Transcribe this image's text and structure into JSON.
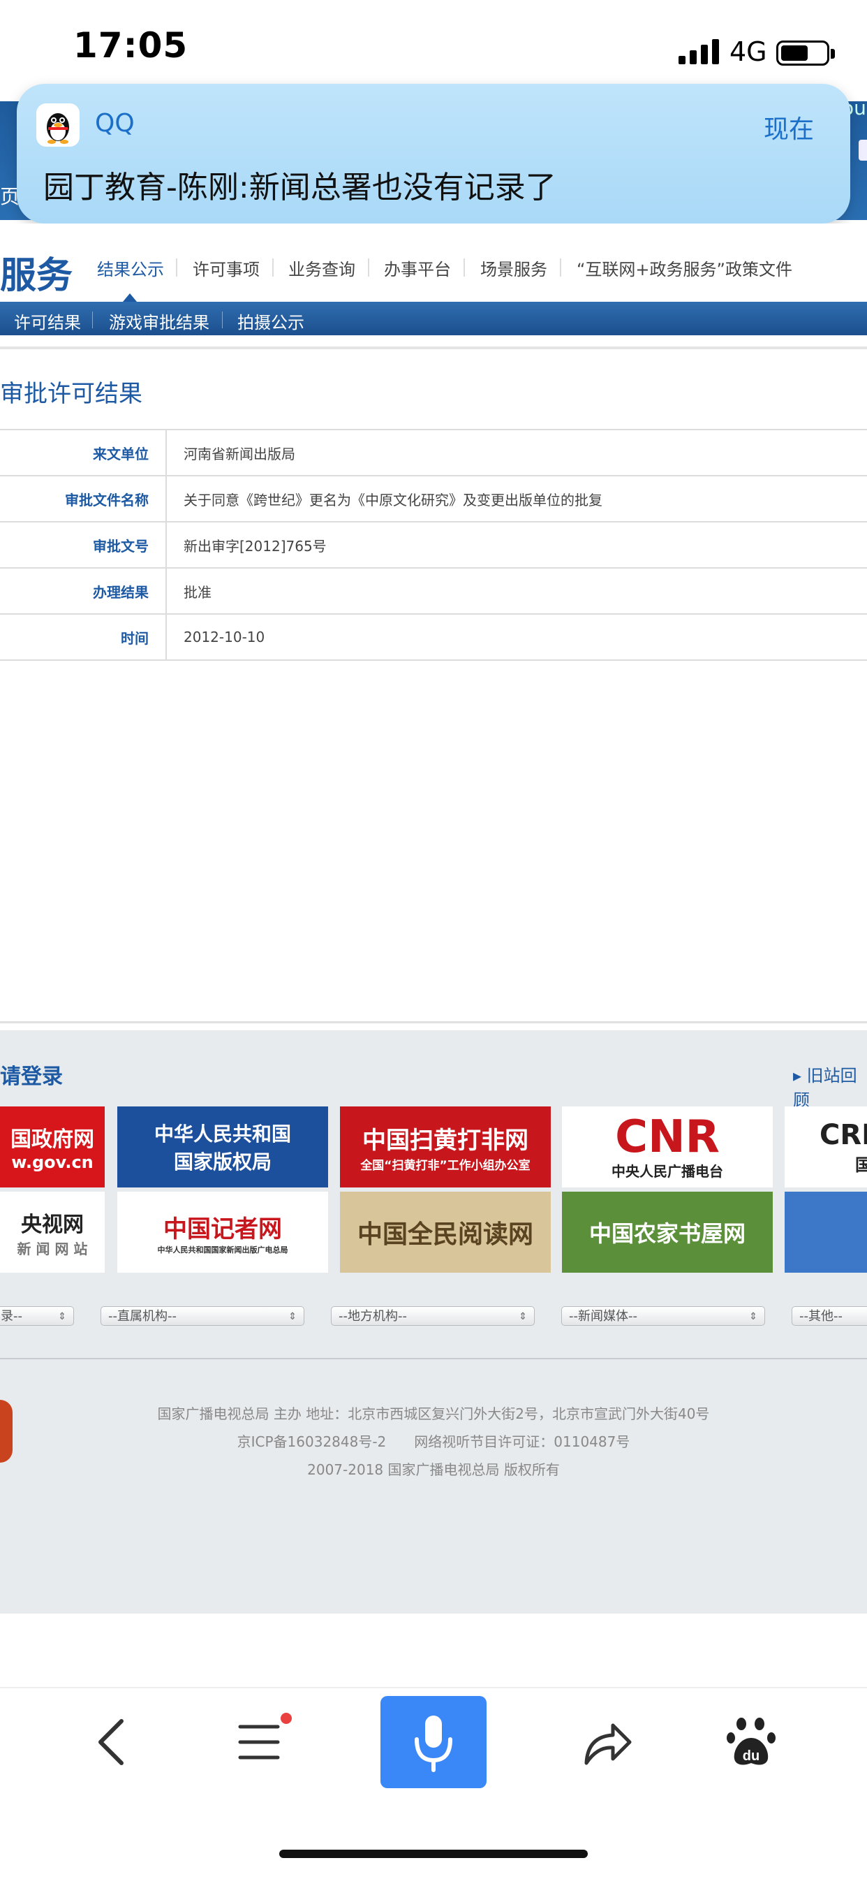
{
  "status_bar": {
    "time": "17:05",
    "network": "4G",
    "battery_level": 0.6
  },
  "notification": {
    "app": "QQ",
    "time": "现在",
    "message": "园丁教育-陈刚:新闻总署也没有记录了"
  },
  "site_header": {
    "left_fragment": "页",
    "right_fragment": "ou"
  },
  "nav": {
    "brand": "服务",
    "items": [
      "结果公示",
      "许可事项",
      "业务查询",
      "办事平台",
      "场景服务",
      "“互联网+政务服务”政策文件"
    ],
    "active": "结果公示"
  },
  "subnav": {
    "items": [
      "许可结果",
      "游戏审批结果",
      "拍摄公示"
    ]
  },
  "page_title": "审批许可结果",
  "table": {
    "rows": [
      {
        "label": "来文单位",
        "value": "河南省新闻出版局"
      },
      {
        "label": "审批文件名称",
        "value": "关于同意《跨世纪》更名为《中原文化研究》及变更出版单位的批复"
      },
      {
        "label": "审批文号",
        "value": "新出审字[2012]765号"
      },
      {
        "label": "办理结果",
        "value": "批准"
      },
      {
        "label": "时间",
        "value": "2012-10-10"
      }
    ]
  },
  "footer": {
    "login": "请登录",
    "old_site": "▸ 旧站回顾",
    "logos_row1": [
      {
        "line1": "国政府网",
        "line2": "w.gov.cn",
        "bg": "#d7161b",
        "fg": "#ffffff"
      },
      {
        "line1": "中华人民共和国",
        "line2": "国家版权局",
        "bg": "#1c4f9c",
        "fg": "#ffffff"
      },
      {
        "line1": "中国扫黄打非网",
        "line2": "全国“扫黄打非”工作小组办公室",
        "bg": "#c8161d",
        "fg": "#ffffff"
      },
      {
        "line1": "CNR",
        "line2": "中央人民广播电台",
        "bg": "#ffffff",
        "fg": "#c8161d"
      },
      {
        "line1": "CRI",
        "line2": "国",
        "bg": "#ffffff",
        "fg": "#222222"
      }
    ],
    "logos_row2": [
      {
        "line1": "央视网",
        "line2": "新 闻 网 站",
        "bg": "#ffffff",
        "fg": "#222222"
      },
      {
        "line1": "中国记者网",
        "line2": "中华人民共和国国家新闻出版广电总局",
        "bg": "#ffffff",
        "fg": "#c8161d"
      },
      {
        "line1": "中国全民阅读网",
        "line2": "",
        "bg": "#d8c59a",
        "fg": "#5a4320"
      },
      {
        "line1": "中国农家书屋网",
        "line2": "",
        "bg": "#5b8f3a",
        "fg": "#ffffff"
      },
      {
        "line1": "",
        "line2": "",
        "bg": "#3d78c8",
        "fg": "#ffffff"
      }
    ],
    "selects": [
      "录--",
      "--直属机构--",
      "--地方机构--",
      "--新闻媒体--",
      "--其他--"
    ],
    "lines": [
      "国家广播电视总局 主办 地址：北京市西城区复兴门外大街2号，北京市宣武门外大街40号",
      "京ICP备16032848号-2　　网络视听节目许可证：0110487号",
      "2007-2018 国家广播电视总局 版权所有"
    ]
  },
  "colors": {
    "accent": "#1d5aa3",
    "notification": "#bfe4fb",
    "mic": "#3a87f7"
  }
}
